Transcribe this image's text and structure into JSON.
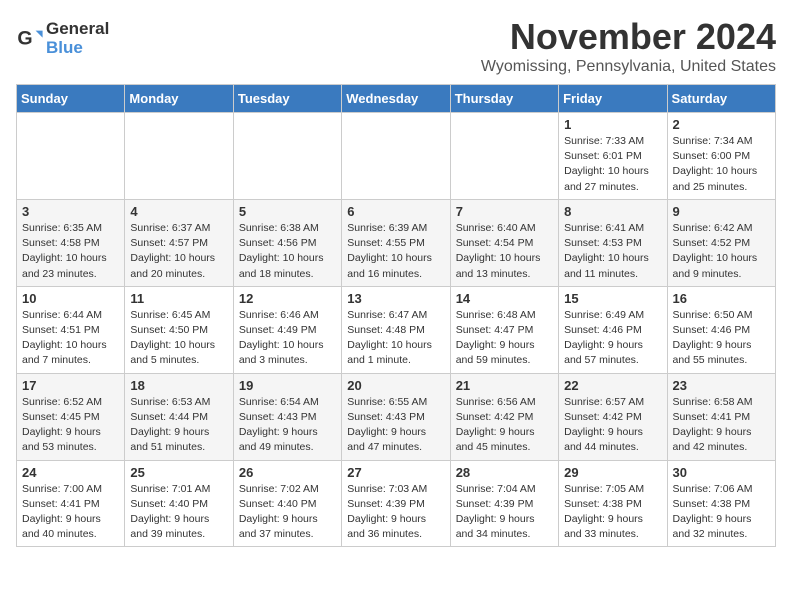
{
  "logo": {
    "line1": "General",
    "line2": "Blue"
  },
  "title": "November 2024",
  "location": "Wyomissing, Pennsylvania, United States",
  "days_of_week": [
    "Sunday",
    "Monday",
    "Tuesday",
    "Wednesday",
    "Thursday",
    "Friday",
    "Saturday"
  ],
  "weeks": [
    [
      {
        "day": "",
        "info": ""
      },
      {
        "day": "",
        "info": ""
      },
      {
        "day": "",
        "info": ""
      },
      {
        "day": "",
        "info": ""
      },
      {
        "day": "",
        "info": ""
      },
      {
        "day": "1",
        "info": "Sunrise: 7:33 AM\nSunset: 6:01 PM\nDaylight: 10 hours and 27 minutes."
      },
      {
        "day": "2",
        "info": "Sunrise: 7:34 AM\nSunset: 6:00 PM\nDaylight: 10 hours and 25 minutes."
      }
    ],
    [
      {
        "day": "3",
        "info": "Sunrise: 6:35 AM\nSunset: 4:58 PM\nDaylight: 10 hours and 23 minutes."
      },
      {
        "day": "4",
        "info": "Sunrise: 6:37 AM\nSunset: 4:57 PM\nDaylight: 10 hours and 20 minutes."
      },
      {
        "day": "5",
        "info": "Sunrise: 6:38 AM\nSunset: 4:56 PM\nDaylight: 10 hours and 18 minutes."
      },
      {
        "day": "6",
        "info": "Sunrise: 6:39 AM\nSunset: 4:55 PM\nDaylight: 10 hours and 16 minutes."
      },
      {
        "day": "7",
        "info": "Sunrise: 6:40 AM\nSunset: 4:54 PM\nDaylight: 10 hours and 13 minutes."
      },
      {
        "day": "8",
        "info": "Sunrise: 6:41 AM\nSunset: 4:53 PM\nDaylight: 10 hours and 11 minutes."
      },
      {
        "day": "9",
        "info": "Sunrise: 6:42 AM\nSunset: 4:52 PM\nDaylight: 10 hours and 9 minutes."
      }
    ],
    [
      {
        "day": "10",
        "info": "Sunrise: 6:44 AM\nSunset: 4:51 PM\nDaylight: 10 hours and 7 minutes."
      },
      {
        "day": "11",
        "info": "Sunrise: 6:45 AM\nSunset: 4:50 PM\nDaylight: 10 hours and 5 minutes."
      },
      {
        "day": "12",
        "info": "Sunrise: 6:46 AM\nSunset: 4:49 PM\nDaylight: 10 hours and 3 minutes."
      },
      {
        "day": "13",
        "info": "Sunrise: 6:47 AM\nSunset: 4:48 PM\nDaylight: 10 hours and 1 minute."
      },
      {
        "day": "14",
        "info": "Sunrise: 6:48 AM\nSunset: 4:47 PM\nDaylight: 9 hours and 59 minutes."
      },
      {
        "day": "15",
        "info": "Sunrise: 6:49 AM\nSunset: 4:46 PM\nDaylight: 9 hours and 57 minutes."
      },
      {
        "day": "16",
        "info": "Sunrise: 6:50 AM\nSunset: 4:46 PM\nDaylight: 9 hours and 55 minutes."
      }
    ],
    [
      {
        "day": "17",
        "info": "Sunrise: 6:52 AM\nSunset: 4:45 PM\nDaylight: 9 hours and 53 minutes."
      },
      {
        "day": "18",
        "info": "Sunrise: 6:53 AM\nSunset: 4:44 PM\nDaylight: 9 hours and 51 minutes."
      },
      {
        "day": "19",
        "info": "Sunrise: 6:54 AM\nSunset: 4:43 PM\nDaylight: 9 hours and 49 minutes."
      },
      {
        "day": "20",
        "info": "Sunrise: 6:55 AM\nSunset: 4:43 PM\nDaylight: 9 hours and 47 minutes."
      },
      {
        "day": "21",
        "info": "Sunrise: 6:56 AM\nSunset: 4:42 PM\nDaylight: 9 hours and 45 minutes."
      },
      {
        "day": "22",
        "info": "Sunrise: 6:57 AM\nSunset: 4:42 PM\nDaylight: 9 hours and 44 minutes."
      },
      {
        "day": "23",
        "info": "Sunrise: 6:58 AM\nSunset: 4:41 PM\nDaylight: 9 hours and 42 minutes."
      }
    ],
    [
      {
        "day": "24",
        "info": "Sunrise: 7:00 AM\nSunset: 4:41 PM\nDaylight: 9 hours and 40 minutes."
      },
      {
        "day": "25",
        "info": "Sunrise: 7:01 AM\nSunset: 4:40 PM\nDaylight: 9 hours and 39 minutes."
      },
      {
        "day": "26",
        "info": "Sunrise: 7:02 AM\nSunset: 4:40 PM\nDaylight: 9 hours and 37 minutes."
      },
      {
        "day": "27",
        "info": "Sunrise: 7:03 AM\nSunset: 4:39 PM\nDaylight: 9 hours and 36 minutes."
      },
      {
        "day": "28",
        "info": "Sunrise: 7:04 AM\nSunset: 4:39 PM\nDaylight: 9 hours and 34 minutes."
      },
      {
        "day": "29",
        "info": "Sunrise: 7:05 AM\nSunset: 4:38 PM\nDaylight: 9 hours and 33 minutes."
      },
      {
        "day": "30",
        "info": "Sunrise: 7:06 AM\nSunset: 4:38 PM\nDaylight: 9 hours and 32 minutes."
      }
    ]
  ]
}
